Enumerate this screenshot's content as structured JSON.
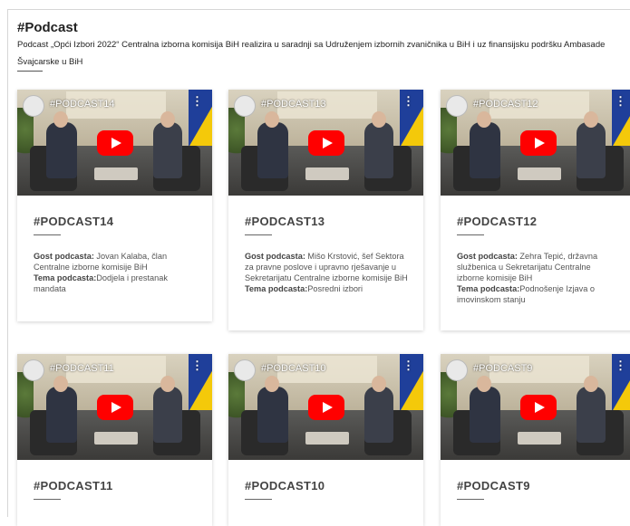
{
  "header": {
    "title": "#Podcast",
    "description": "Podcast „Opći Izbori 2022“ Centralna izborna komisija BiH realizira u saradnji sa Udruženjem izbornih zvaničnika u BiH i uz finansijsku podršku Ambasade Švajcarske u BiH"
  },
  "cards": [
    {
      "video_title": "#PODCAST14",
      "label": "#PODCAST14",
      "guest_label": "Gost podcasta:",
      "guest": " Jovan Kalaba, član Centralne izborne komisije BiH",
      "topic_label": "Tema podcasta:",
      "topic": "Dodjela i prestanak mandata"
    },
    {
      "video_title": "#PODCAST13",
      "label": "#PODCAST13",
      "guest_label": "Gost podcasta:",
      "guest": " Mišo Krstović, šef Sektora za pravne poslove i upravno rješavanje u Sekretarijatu Centralne izborne komisije BiH",
      "topic_label": "Tema podcasta:",
      "topic": "Posredni izbori"
    },
    {
      "video_title": "#PODCAST12",
      "label": "#PODCAST12",
      "guest_label": "Gost podcasta:",
      "guest": " Zehra Tepić, državna službenica u Sekretarijatu Centralne izborne komisije BiH",
      "topic_label": "Tema podcasta:",
      "topic": "Podnošenje Izjava o imovinskom stanju"
    },
    {
      "video_title": "#PODCAST11",
      "label": "#PODCAST11"
    },
    {
      "video_title": "#PODCAST10",
      "label": "#PODCAST10"
    },
    {
      "video_title": "#PODCAST9",
      "label": "#PODCAST9"
    }
  ],
  "icons": {
    "play": "youtube-play-icon",
    "menu": "more-vertical-icon",
    "channel": "channel-avatar-icon"
  },
  "colors": {
    "play": "#ff0000",
    "flag_blue": "#1f3f9a",
    "flag_yellow": "#f4c90a"
  }
}
